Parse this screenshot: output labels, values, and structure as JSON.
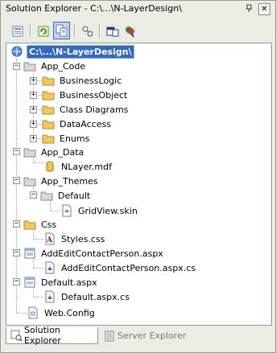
{
  "window": {
    "title": "Solution Explorer - C:\\...\\N-LayerDesign\\"
  },
  "title_controls": {
    "pin_icon": "pin-icon",
    "close_glyph": "✕"
  },
  "toolbar": {
    "buttons": [
      "properties",
      "refresh",
      "show-all-files",
      "nest-related-files",
      "view-class-diagram",
      "copy-web-site",
      "asp-net-configuration"
    ]
  },
  "tree": {
    "root": "C:\\...\\N-LayerDesign\\",
    "app_code": "App_Code",
    "business_logic": "BusinessLogic",
    "business_object": "BusinessObject",
    "class_diagrams": "Class Diagrams",
    "data_access": "DataAccess",
    "enums": "Enums",
    "app_data": "App_Data",
    "nlayer_mdf": "NLayer.mdf",
    "app_themes": "App_Themes",
    "default_theme": "Default",
    "gridview_skin": "GridView.skin",
    "css": "Css",
    "styles_css": "Styles.css",
    "addedit_aspx": "AddEditContactPerson.aspx",
    "addedit_cs": "AddEditContactPerson.aspx.cs",
    "default_aspx": "Default.aspx",
    "default_cs": "Default.aspx.cs",
    "web_config": "Web.Config"
  },
  "tabs": {
    "solution_explorer": "Solution Explorer",
    "server_explorer": "Server Explorer"
  },
  "colors": {
    "selection": "#316ac5",
    "folder": "#f2c75c",
    "panel_border": "#7f9db9"
  }
}
